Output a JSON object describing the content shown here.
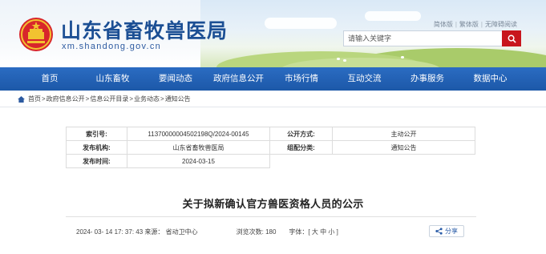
{
  "header": {
    "site_title": "山东省畜牧兽医局",
    "site_domain": "xm.shandong.gov.cn",
    "top_links": [
      "简体版",
      "繁体版",
      "无障碍阅读"
    ],
    "search_placeholder": "请输入关键字"
  },
  "nav": {
    "items": [
      "首页",
      "山东畜牧",
      "要闻动态",
      "政府信息公开",
      "市场行情",
      "互动交流",
      "办事服务",
      "数据中心"
    ]
  },
  "breadcrumb": {
    "items": [
      "首页",
      "政府信息公开",
      "信息公开目录",
      "业务动态",
      "通知公告"
    ]
  },
  "info_table": {
    "index_label": "索引号:",
    "index_value": "11370000004502198Q/2024-00145",
    "open_mode_label": "公开方式:",
    "open_mode_value": "主动公开",
    "issuer_label": "发布机构:",
    "issuer_value": "山东省畜牧兽医局",
    "category_label": "组配分类:",
    "category_value": "通知公告",
    "date_label": "发布时间:",
    "date_value": "2024-03-15"
  },
  "article": {
    "title": "关于拟新确认官方兽医资格人员的公示",
    "meta_time_source": "2024- 03- 14 17: 37: 43 来源： 省动卫中心",
    "views": "浏览次数: 180",
    "font_label": "字体：",
    "font_options": [
      "[",
      "大",
      "中",
      "小",
      "]"
    ],
    "share_label": "分享"
  },
  "colors": {
    "brand_blue": "#1c4f94",
    "nav_blue": "#1f5fb4",
    "search_red": "#c8161d"
  }
}
